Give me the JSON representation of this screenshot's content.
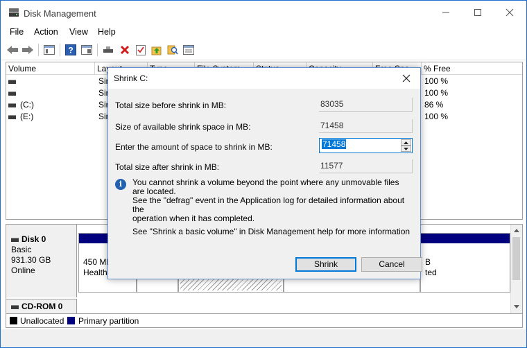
{
  "window": {
    "title": "Disk Management"
  },
  "menu": [
    "File",
    "Action",
    "View",
    "Help"
  ],
  "toolbar_icons": [
    "back-arrow-icon",
    "forward-arrow-icon",
    "console-tree-icon",
    "help-icon",
    "properties-icon",
    "connect-drive-icon",
    "delete-icon",
    "checklist-icon",
    "folder-up-icon",
    "search-icon",
    "settings-panel-icon"
  ],
  "list": {
    "columns": [
      "Volume",
      "Layout",
      "Type",
      "File System",
      "Status",
      "Capacity",
      "Free Spa...",
      "% Free"
    ],
    "rows": [
      {
        "volume": "",
        "layout": "Sir",
        "free_pct": "100 %"
      },
      {
        "volume": "",
        "layout": "Sir",
        "free_pct": "100 %"
      },
      {
        "volume": "(C:)",
        "layout": "Sir",
        "free_pct": "86 %"
      },
      {
        "volume": "(E:)",
        "layout": "Sir",
        "free_pct": "100 %"
      }
    ]
  },
  "graph": {
    "disk0": {
      "name": "Disk 0",
      "type": "Basic",
      "size": "931.30 GB",
      "status": "Online"
    },
    "partitions": [
      {
        "line1": "450 ME",
        "line2": "Healthy"
      },
      {
        "line1": "B",
        "line2": "ted"
      }
    ],
    "cdrom": {
      "name": "CD-ROM 0"
    }
  },
  "legend": [
    {
      "label": "Unallocated",
      "color": "#000000"
    },
    {
      "label": "Primary partition",
      "color": "#00007f"
    }
  ],
  "dialog": {
    "title": "Shrink C:",
    "fields": [
      {
        "label": "Total size before shrink in MB:",
        "value": "83035"
      },
      {
        "label": "Size of available shrink space in MB:",
        "value": "71458"
      },
      {
        "label": "Enter the amount of space to shrink in MB:",
        "value": "71458"
      },
      {
        "label": "Total size after shrink in MB:",
        "value": "11577"
      }
    ],
    "info_lines": [
      "You cannot shrink a volume beyond the point where any unmovable files are located.",
      "See the \"defrag\" event in the Application log for detailed information about the",
      "operation when it has completed."
    ],
    "help_text": "See \"Shrink a basic volume\" in Disk Management help for more information",
    "shrink_label": "Shrink",
    "cancel_label": "Cancel"
  },
  "colors": {
    "accent": "#0078d7",
    "primary_partition": "#00007f",
    "info": "#2261b1"
  }
}
